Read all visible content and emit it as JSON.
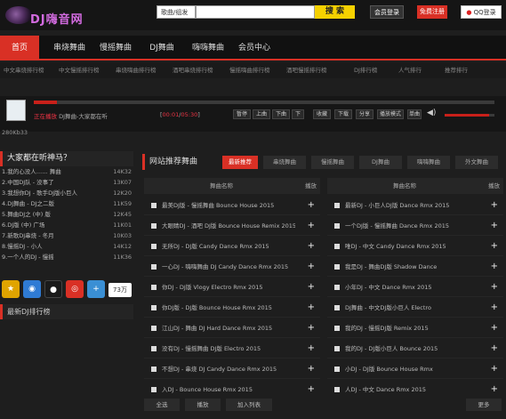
{
  "header": {
    "logo_text": "DJ嗨音网",
    "search_type": "歌曲/组发",
    "search_placeholder": "",
    "search_button": "搜 索",
    "login_button": "会员登录",
    "register_button": "免费注册",
    "qq_button": "QQ登录"
  },
  "nav": {
    "items": [
      "首页",
      "串烧舞曲",
      "慢摇舞曲",
      "DJ舞曲",
      "嗨嗨舞曲",
      "会员中心"
    ]
  },
  "subnav": {
    "items": [
      "中文串烧排行榜",
      "中文慢摇排行榜",
      "串烧嗨曲排行榜",
      "酒吧串烧排行榜",
      "慢摇嗨曲排行榜",
      "酒吧慢摇排行榜",
      "DJ排行榜",
      "人气排行",
      "推荐排行"
    ]
  },
  "player": {
    "now_playing_prefix": "正在播放",
    "now_playing_title": "DJ舞曲-大家都在听",
    "time_current": "00:01",
    "time_total": "05:30",
    "time_prefix": "[",
    "progress": 0.05,
    "volume": 0.9,
    "controls": [
      "暂停",
      "上曲",
      "下曲",
      "下",
      "收藏",
      "下载",
      "分享",
      "播放模式",
      "单曲"
    ],
    "count_label": "280Kb33"
  },
  "left": {
    "title": "大家都在听神马？",
    "songs": [
      {
        "name": "1.我的心没人…… 舞曲",
        "count": "14K32"
      },
      {
        "name": "2.中国DJ队 - 没事了",
        "count": "13K07"
      },
      {
        "name": "3.我想你DJ - 歌手DJ版小巨人",
        "count": "12K20"
      },
      {
        "name": "4.DJ舞曲 - DJ之二版",
        "count": "11K59"
      },
      {
        "name": "5.舞曲DJ之 (中) 版",
        "count": "12K45"
      },
      {
        "name": "6.DJ版 (中) 广场",
        "count": "11K01"
      },
      {
        "name": "7.新歌DJ串烧 - 冬月",
        "count": "10K03"
      },
      {
        "name": "8.慢摇DJ - 小人",
        "count": "14K12"
      },
      {
        "name": "9.一个人的DJ - 慢摇",
        "count": "11K36"
      }
    ],
    "share_count": "73万",
    "section2_title": "最新DJ排行榜"
  },
  "right": {
    "title": "网站推荐舞曲",
    "tabs": [
      "最新推荐",
      "串烧舞曲",
      "慢摇舞曲",
      "DJ舞曲",
      "嗨嗨舞曲",
      "外文舞曲"
    ],
    "column_header": "舞曲名称",
    "column_action": "播放",
    "songs_left": [
      "最美DJ版 - 慢摇舞曲 Bounce House 2015",
      "大眼睛DJ - 酒吧 DJ版 Bounce House Remix 2015",
      "无所DJ - DJ版 Candy Dance Rmx 2015",
      "一心DJ - 嗨嗨舞曲 DJ Candy Dance Rmx 2015",
      "你DJ - DJ版 Vlogy Electro Rmx 2015",
      "你DJ版 - DJ版 Bounce House Rmx 2015",
      "江山DJ - 舞曲 DJ Hard Dance Rmx 2015",
      "没有DJ - 慢摇舞曲 DJ版 Electro 2015",
      "不想DJ - 串烧 DJ Candy Dance Rmx 2015",
      "入DJ - Bounce House Rmx 2015"
    ],
    "songs_right": [
      "最新DJ - 小巨人DJ版 Dance Rmx 2015",
      "一个DJ版 - 慢摇舞曲 Dance Rmx 2015",
      "唯DJ - 中文 Candy Dance Rmx 2015",
      "我是DJ - 舞曲DJ版 Shadow Dance",
      "小年DJ - 中文 Dance Rmx 2015",
      "DJ舞曲 - 中文DJ版小巨人 Electro",
      "我的DJ - 慢摇DJ版 Remix 2015",
      "我的DJ - DJ版小巨人 Bounce 2015",
      "小DJ - DJ版 Bounce House Rmx",
      "人DJ - 中文 Dance Rmx 2015"
    ],
    "bottom_buttons": [
      "全选",
      "播放",
      "加入列表"
    ],
    "more_label": "更多"
  }
}
